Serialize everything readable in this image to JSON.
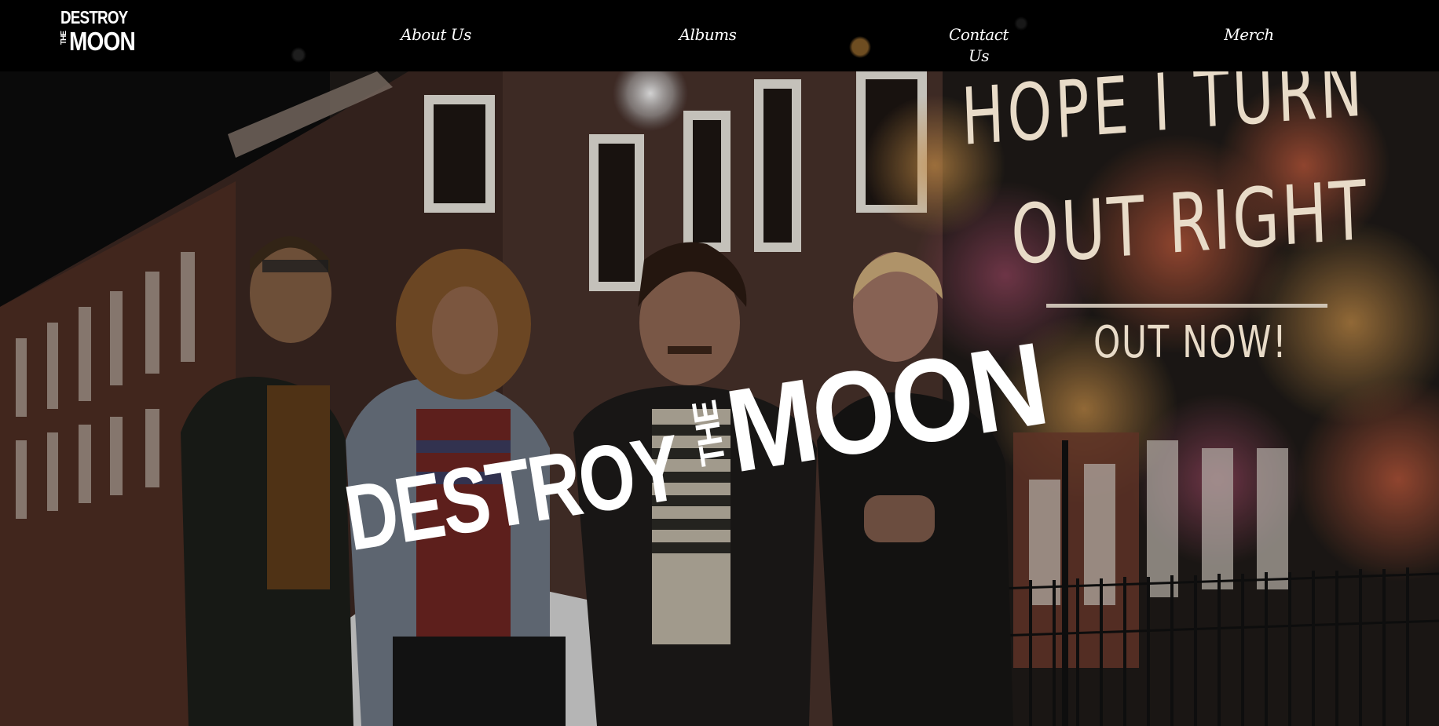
{
  "site": {
    "logo_text": {
      "destroy": "DESTROY",
      "the": "THE",
      "moon": "MOON"
    }
  },
  "nav": {
    "items": [
      {
        "label": "About Us"
      },
      {
        "label": "Albums"
      },
      {
        "label": "Contact Us"
      },
      {
        "label": "Merch"
      }
    ]
  },
  "hero": {
    "wordmark": {
      "destroy": "DESTROY",
      "the": "THE",
      "moon": "MOON"
    },
    "poster": {
      "line1": "HOPE I TURN",
      "line2": "OUT RIGHT",
      "line3": "OUT NOW!"
    }
  },
  "colors": {
    "nav_bg": "#000000",
    "nav_text": "#ffffff",
    "wordmark": "#ffffff",
    "poster_text": "#e8dbc8"
  }
}
